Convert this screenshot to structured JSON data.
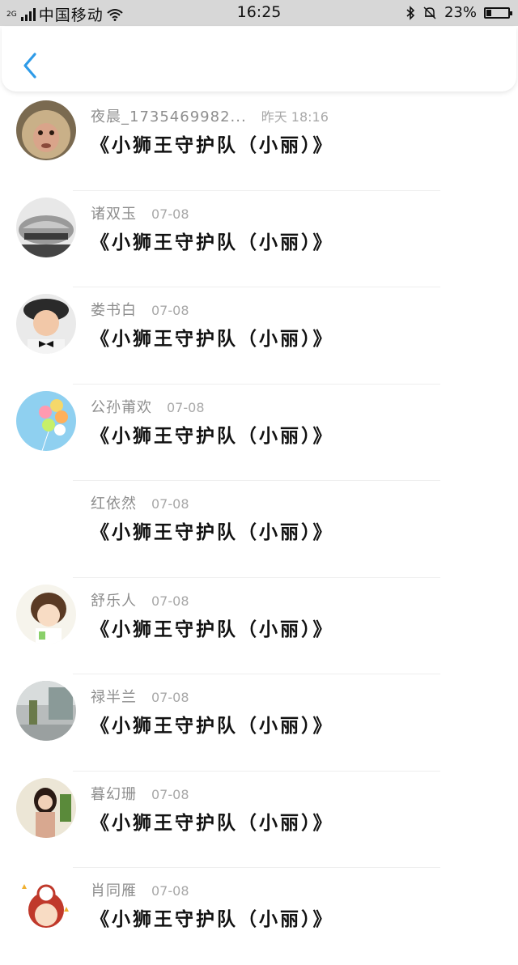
{
  "status": {
    "net": "2G",
    "carrier": "中国移动",
    "time": "16:25",
    "battery": "23%",
    "battery_level": 0.23
  },
  "rows": [
    {
      "name": "夜晨_1735469982...",
      "date": "昨天 18:16",
      "title": "《小狮王守护队（小丽）》",
      "avatar": "monkey-avatar"
    },
    {
      "name": "诸双玉",
      "date": "07-08",
      "title": "《小狮王守护队（小丽）》",
      "avatar": "car-avatar"
    },
    {
      "name": "娄书白",
      "date": "07-08",
      "title": "《小狮王守护队（小丽）》",
      "avatar": "child-avatar"
    },
    {
      "name": "公孙莆欢",
      "date": "07-08",
      "title": "《小狮王守护队（小丽）》",
      "avatar": "balloons-avatar"
    },
    {
      "name": "红依然",
      "date": "07-08",
      "title": "《小狮王守护队（小丽）》",
      "avatar": "blank-avatar"
    },
    {
      "name": "舒乐人",
      "date": "07-08",
      "title": "《小狮王守护队（小丽）》",
      "avatar": "cartoon-girl-avatar"
    },
    {
      "name": "禄半兰",
      "date": "07-08",
      "title": "《小狮王守护队（小丽）》",
      "avatar": "street-avatar"
    },
    {
      "name": "暮幻珊",
      "date": "07-08",
      "title": "《小狮王守护队（小丽）》",
      "avatar": "woman-avatar"
    },
    {
      "name": "肖同雁",
      "date": "07-08",
      "title": "《小狮王守护队（小丽）》",
      "avatar": "cartoon-avatar"
    }
  ]
}
